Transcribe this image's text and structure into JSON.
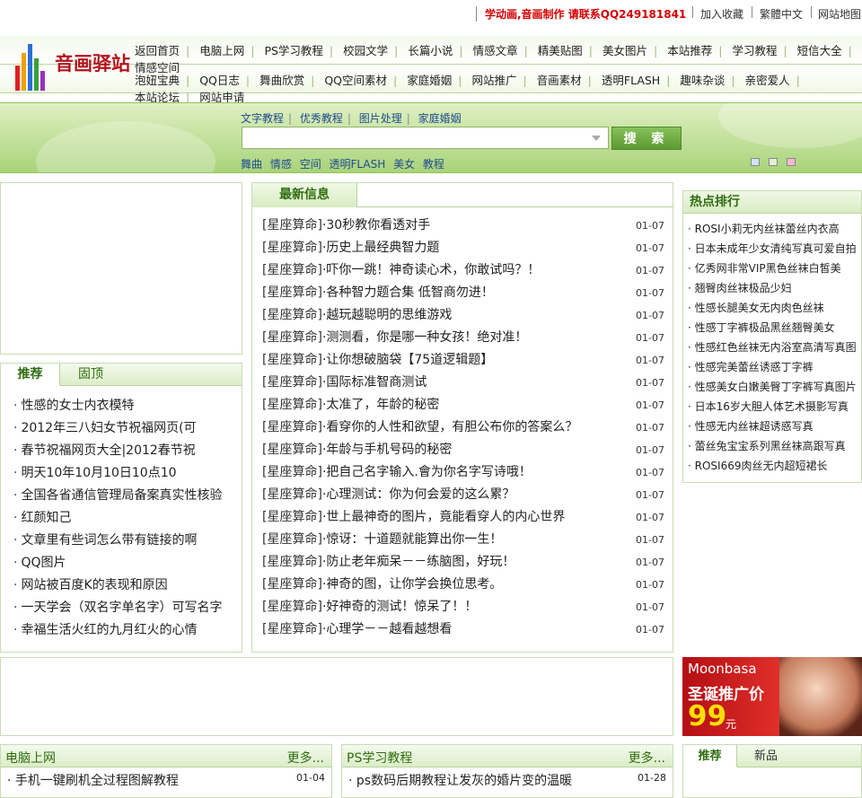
{
  "topbar": {
    "promo": "学动画,音画制作 请联系QQ249181841",
    "links": [
      "加入收藏",
      "繁體中文",
      "网站地图"
    ]
  },
  "logo": {
    "text": "音画驿站"
  },
  "nav": {
    "row1": [
      "返回首页",
      "电脑上网",
      "PS学习教程",
      "校园文学",
      "长篇小说",
      "情感文章",
      "精美贴图",
      "美女图片",
      "本站推荐",
      "学习教程",
      "短信大全",
      "情感空间"
    ],
    "row2": [
      "泡妞宝典",
      "QQ日志",
      "舞曲欣赏",
      "QQ空间素材",
      "家庭婚姻",
      "网站推广",
      "音画素材",
      "透明FLASH",
      "趣味杂谈",
      "亲密爱人",
      "本站论坛",
      "网站申请"
    ]
  },
  "search": {
    "tabs": [
      "文字教程",
      "优秀教程",
      "图片处理",
      "家庭婚姻"
    ],
    "input_value": "",
    "button_label": "搜 索",
    "hot_keywords": [
      "舞曲",
      "情感",
      "空间",
      "透明FLASH",
      "美女",
      "教程"
    ],
    "color_swatches": [
      "#cfe3f7",
      "#e4efd5",
      "#f5b9cf"
    ]
  },
  "left_tabs": {
    "tabs": [
      "推荐",
      "固顶"
    ],
    "items": [
      "性感的女士内衣模特",
      "2012年三八妇女节祝福网页(可",
      "春节祝福网页大全|2012春节祝",
      "明天10年10月10日10点10",
      "全国各省通信管理局备案真实性核验",
      "红颜知己",
      "文章里有些词怎么带有链接的啊",
      "QQ图片",
      "网站被百度K的表现和原因",
      "一天学会（双名字单名字）可写名字",
      "幸福生活火红的九月红火的心情"
    ]
  },
  "latest": {
    "title": "最新信息",
    "category": "[星座算命]",
    "items": [
      {
        "title": "30秒教你看透对手",
        "date": "01-07"
      },
      {
        "title": "历史上最经典智力题",
        "date": "01-07"
      },
      {
        "title": "吓你一跳！神奇读心术，你敢试吗？！",
        "date": "01-07"
      },
      {
        "title": "各种智力题合集 低智商勿进！",
        "date": "01-07"
      },
      {
        "title": "越玩越聪明的思维游戏",
        "date": "01-07"
      },
      {
        "title": "测测看，你是哪一种女孩！绝对准！",
        "date": "01-07"
      },
      {
        "title": "让你想破脑袋【75道逻辑题】",
        "date": "01-07"
      },
      {
        "title": "国际标准智商测试",
        "date": "01-07"
      },
      {
        "title": "太准了，年龄的秘密",
        "date": "01-07"
      },
      {
        "title": "看穿你的人性和欲望，有胆公布你的答案么？",
        "date": "01-07"
      },
      {
        "title": "年龄与手机号码的秘密",
        "date": "01-07"
      },
      {
        "title": "把自己名字输入.會为你名字写诗哦！",
        "date": "01-07"
      },
      {
        "title": "心理测试：你为何会爱的这么累？",
        "date": "01-07"
      },
      {
        "title": "世上最神奇的图片，竟能看穿人的内心世界",
        "date": "01-07"
      },
      {
        "title": "惊讶：十道题就能算出你一生！",
        "date": "01-07"
      },
      {
        "title": "防止老年痴呆－－练脑图，好玩！",
        "date": "01-07"
      },
      {
        "title": "神奇的图，让你学会换位思考。",
        "date": "01-07"
      },
      {
        "title": "好神奇的测试！惊呆了！！",
        "date": "01-07"
      },
      {
        "title": "心理学－－越看越想看",
        "date": "01-07"
      }
    ]
  },
  "hot": {
    "title": "热点排行",
    "items": [
      "ROSI小莉无内丝袜蕾丝内衣高",
      "日本未成年少女清纯写真可爱自拍",
      "亿秀网非常VIP黑色丝袜白皙美",
      "翘臀肉丝袜极品少妇",
      "性感长腿美女无内肉色丝袜",
      "性感丁字裤极品黑丝翘臀美女",
      "性感红色丝袜无内浴室高清写真图",
      "性感完美蕾丝诱惑丁字裤",
      "性感美女白嫩美臀丁字裤写真图片",
      "日本16岁大胆人体艺术摄影写真",
      "性感无内丝袜超诱惑写真",
      "蕾丝兔宝宝系列黑丝袜高跟写真",
      "ROSI669肉丝无内超短裙长"
    ]
  },
  "ad_right": {
    "brand": "Moonbasa",
    "slogan": "圣诞推广价",
    "price": "99",
    "unit": "元"
  },
  "bottom": {
    "box1": {
      "title": "电脑上网",
      "more": "更多...",
      "item": "手机一键刷机全过程图解教程",
      "date": "01-04"
    },
    "box2": {
      "title": "PS学习教程",
      "more": "更多...",
      "item": "ps数码后期教程让发灰的婚片变的温暖",
      "date": "01-28"
    },
    "box3": {
      "tabs": [
        "推荐",
        "新品"
      ]
    }
  }
}
